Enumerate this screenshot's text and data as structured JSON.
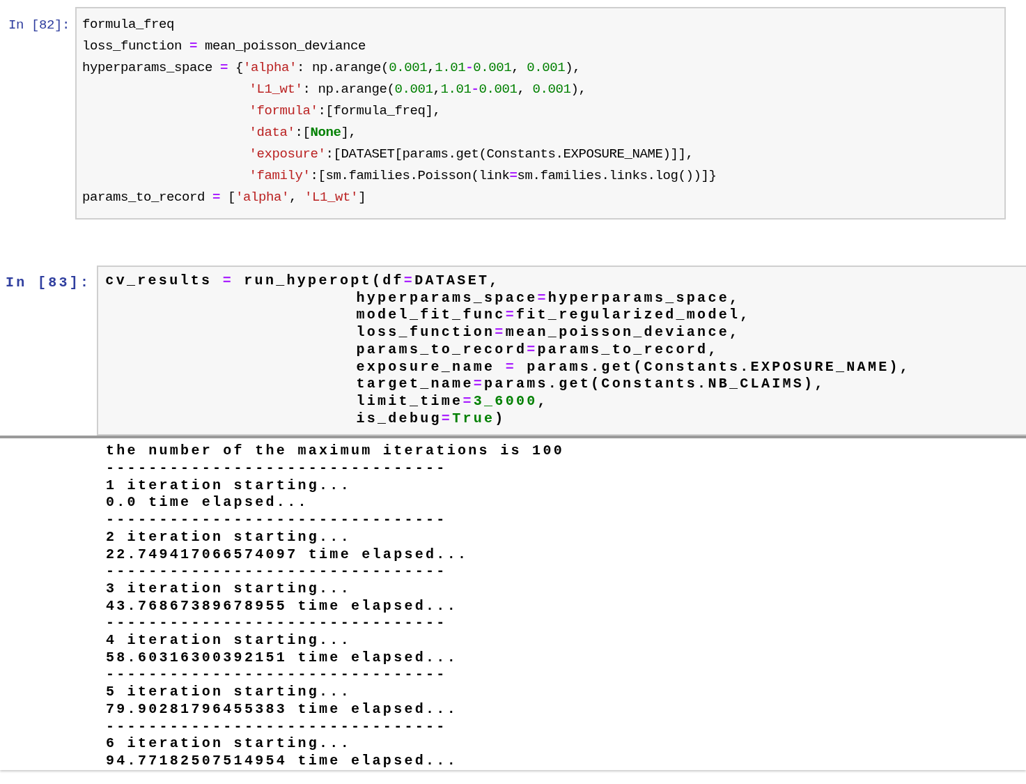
{
  "cells": [
    {
      "kind": "code",
      "prompt": "In [82]:",
      "lines": [
        {
          "indented": false,
          "tokens": [
            {
              "kind": "name",
              "text": "formula_freq"
            }
          ]
        },
        {
          "indented": false,
          "tokens": [
            {
              "kind": "name",
              "text": "loss_function "
            },
            {
              "kind": "op",
              "text": "="
            },
            {
              "kind": "name",
              "text": " mean_poisson_deviance"
            }
          ]
        },
        {
          "indented": false,
          "tokens": [
            {
              "kind": "name",
              "text": "hyperparams_space "
            },
            {
              "kind": "op",
              "text": "="
            },
            {
              "kind": "name",
              "text": " {"
            },
            {
              "kind": "str",
              "text": "'alpha'"
            },
            {
              "kind": "name",
              "text": ": np.arange("
            },
            {
              "kind": "num",
              "text": "0.001"
            },
            {
              "kind": "name",
              "text": ","
            },
            {
              "kind": "num",
              "text": "1.01"
            },
            {
              "kind": "op",
              "text": "-"
            },
            {
              "kind": "num",
              "text": "0.001"
            },
            {
              "kind": "name",
              "text": ", "
            },
            {
              "kind": "num",
              "text": "0.001"
            },
            {
              "kind": "name",
              "text": "),"
            }
          ]
        },
        {
          "indented": true,
          "tokens": [
            {
              "kind": "str",
              "text": "'L1_wt'"
            },
            {
              "kind": "name",
              "text": ": np.arange("
            },
            {
              "kind": "num",
              "text": "0.001"
            },
            {
              "kind": "name",
              "text": ","
            },
            {
              "kind": "num",
              "text": "1.01"
            },
            {
              "kind": "op",
              "text": "-"
            },
            {
              "kind": "num",
              "text": "0.001"
            },
            {
              "kind": "name",
              "text": ", "
            },
            {
              "kind": "num",
              "text": "0.001"
            },
            {
              "kind": "name",
              "text": "),"
            }
          ]
        },
        {
          "indented": true,
          "tokens": [
            {
              "kind": "str",
              "text": "'formula'"
            },
            {
              "kind": "name",
              "text": ":[formula_freq],"
            }
          ]
        },
        {
          "indented": true,
          "tokens": [
            {
              "kind": "str",
              "text": "'data'"
            },
            {
              "kind": "name",
              "text": ":["
            },
            {
              "kind": "kw",
              "text": "None"
            },
            {
              "kind": "name",
              "text": "],"
            }
          ]
        },
        {
          "indented": true,
          "tokens": [
            {
              "kind": "str",
              "text": "'exposure'"
            },
            {
              "kind": "name",
              "text": ":[DATASET[params.get(Constants.EXPOSURE_NAME)]],"
            }
          ]
        },
        {
          "indented": true,
          "tokens": [
            {
              "kind": "str",
              "text": "'family'"
            },
            {
              "kind": "name",
              "text": ":[sm.families.Poisson(link"
            },
            {
              "kind": "op",
              "text": "="
            },
            {
              "kind": "name",
              "text": "sm.families.links.log())]}"
            }
          ]
        },
        {
          "indented": false,
          "tokens": [
            {
              "kind": "name",
              "text": "params_to_record "
            },
            {
              "kind": "op",
              "text": "="
            },
            {
              "kind": "name",
              "text": " ["
            },
            {
              "kind": "str",
              "text": "'alpha'"
            },
            {
              "kind": "name",
              "text": ", "
            },
            {
              "kind": "str",
              "text": "'L1_wt'"
            },
            {
              "kind": "name",
              "text": "]"
            }
          ]
        }
      ]
    },
    {
      "kind": "code",
      "prompt": "In [83]:",
      "lines": [
        {
          "indented": false,
          "tokens": [
            {
              "kind": "name",
              "text": "cv_results "
            },
            {
              "kind": "op",
              "text": "="
            },
            {
              "kind": "name",
              "text": " run_hyperopt(df"
            },
            {
              "kind": "op",
              "text": "="
            },
            {
              "kind": "name",
              "text": "DATASET,"
            }
          ]
        },
        {
          "indented": true,
          "tokens": [
            {
              "kind": "name",
              "text": "hyperparams_space"
            },
            {
              "kind": "op",
              "text": "="
            },
            {
              "kind": "name",
              "text": "hyperparams_space,"
            }
          ]
        },
        {
          "indented": true,
          "tokens": [
            {
              "kind": "name",
              "text": "model_fit_func"
            },
            {
              "kind": "op",
              "text": "="
            },
            {
              "kind": "name",
              "text": "fit_regularized_model,"
            }
          ]
        },
        {
          "indented": true,
          "tokens": [
            {
              "kind": "name",
              "text": "loss_function"
            },
            {
              "kind": "op",
              "text": "="
            },
            {
              "kind": "name",
              "text": "mean_poisson_deviance,"
            }
          ]
        },
        {
          "indented": true,
          "tokens": [
            {
              "kind": "name",
              "text": "params_to_record"
            },
            {
              "kind": "op",
              "text": "="
            },
            {
              "kind": "name",
              "text": "params_to_record,"
            }
          ]
        },
        {
          "indented": true,
          "tokens": [
            {
              "kind": "name",
              "text": "exposure_name "
            },
            {
              "kind": "op",
              "text": "="
            },
            {
              "kind": "name",
              "text": " params.get(Constants.EXPOSURE_NAME),"
            }
          ]
        },
        {
          "indented": true,
          "tokens": [
            {
              "kind": "name",
              "text": "target_name"
            },
            {
              "kind": "op",
              "text": "="
            },
            {
              "kind": "name",
              "text": "params.get(Constants.NB_CLAIMS),"
            }
          ]
        },
        {
          "indented": true,
          "tokens": [
            {
              "kind": "name",
              "text": "limit_time"
            },
            {
              "kind": "op",
              "text": "="
            },
            {
              "kind": "num",
              "text": "3_6000"
            },
            {
              "kind": "name",
              "text": ","
            }
          ]
        },
        {
          "indented": true,
          "tokens": [
            {
              "kind": "name",
              "text": "is_debug"
            },
            {
              "kind": "op",
              "text": "="
            },
            {
              "kind": "kw",
              "text": "True"
            },
            {
              "kind": "name",
              "text": ")"
            }
          ]
        }
      ],
      "output": [
        "the number of the maximum iterations is 100",
        "--------------------------------",
        "1 iteration starting...",
        "0.0 time elapsed...",
        "--------------------------------",
        "2 iteration starting...",
        "22.749417066574097 time elapsed...",
        "--------------------------------",
        "3 iteration starting...",
        "43.76867389678955 time elapsed...",
        "--------------------------------",
        "4 iteration starting...",
        "58.60316300392151 time elapsed...",
        "--------------------------------",
        "5 iteration starting...",
        "79.90281796455383 time elapsed...",
        "--------------------------------",
        "6 iteration starting...",
        "94.77182507514954 time elapsed..."
      ]
    }
  ]
}
